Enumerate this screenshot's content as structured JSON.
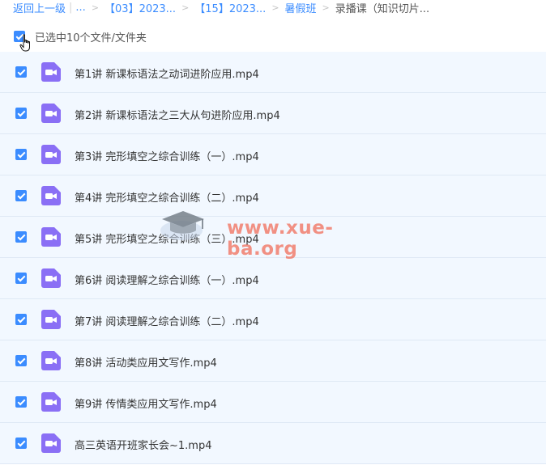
{
  "breadcrumb": {
    "back": "返回上一级",
    "ellipsis": "...",
    "items": [
      "【03】2023...",
      "【15】2023...",
      "暑假班"
    ],
    "current": "录播课（知识切片..."
  },
  "selection": {
    "summary": "已选中10个文件/文件夹"
  },
  "files": [
    {
      "name": "第1讲 新课标语法之动词进阶应用.mp4"
    },
    {
      "name": "第2讲 新课标语法之三大从句进阶应用.mp4"
    },
    {
      "name": "第3讲 完形填空之综合训练（一）.mp4"
    },
    {
      "name": "第4讲 完形填空之综合训练（二）.mp4"
    },
    {
      "name": "第5讲 完形填空之综合训练（三）.mp4"
    },
    {
      "name": "第6讲 阅读理解之综合训练（一）.mp4"
    },
    {
      "name": "第7讲 阅读理解之综合训练（二）.mp4"
    },
    {
      "name": "第8讲 活动类应用文写作.mp4"
    },
    {
      "name": "第9讲 传情类应用文写作.mp4"
    },
    {
      "name": "高三英语开班家长会~1.mp4"
    }
  ],
  "watermark": {
    "text": "www.xue-ba.org"
  },
  "colors": {
    "accent": "#3b8cff",
    "video_icon": "#8a6ff5",
    "row_bg": "#f2f8ff"
  }
}
